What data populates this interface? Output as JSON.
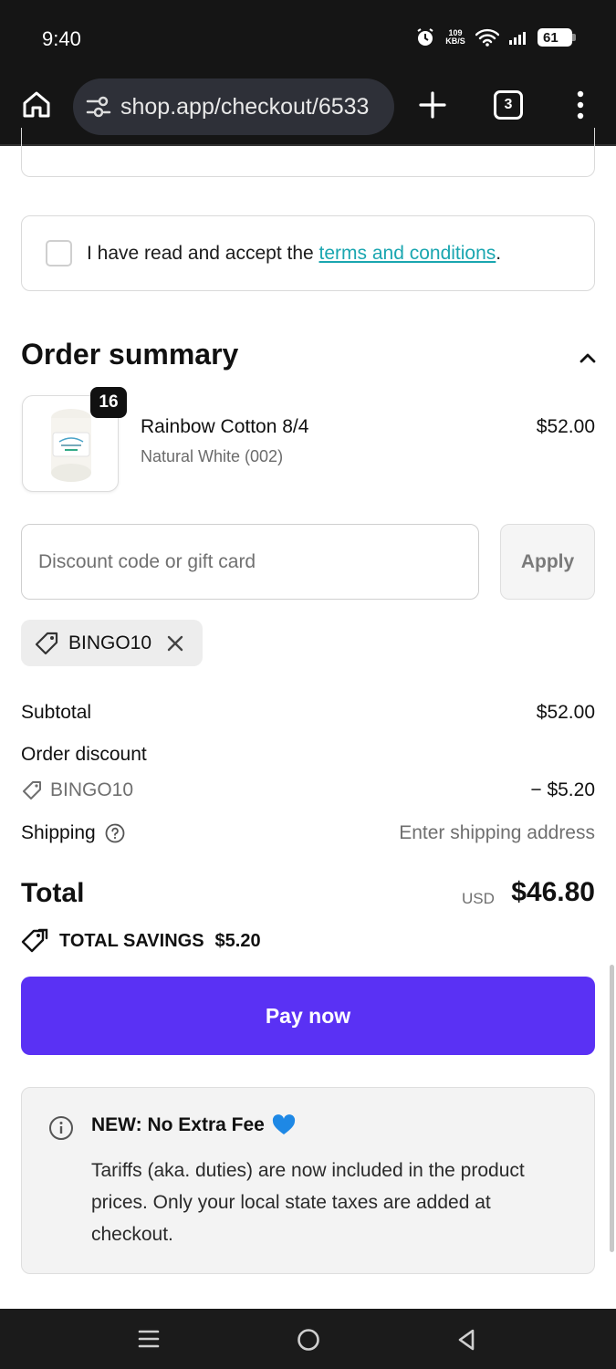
{
  "status_bar": {
    "time": "9:40",
    "net_speed_value": "109",
    "net_speed_unit": "KB/S",
    "battery": "61"
  },
  "browser": {
    "url": "shop.app/checkout/6533",
    "tab_count": "3",
    "icons": [
      "home-icon",
      "tune-icon",
      "plus-icon",
      "tabs-icon",
      "more-vert-icon"
    ]
  },
  "terms": {
    "prefix": "I have read and accept the ",
    "link": "terms and conditions",
    "suffix": "."
  },
  "summary": {
    "title": "Order summary",
    "item": {
      "quantity": "16",
      "name": "Rainbow Cotton 8/4",
      "variant": "Natural White (002)",
      "price": "$52.00"
    },
    "discount_placeholder": "Discount code or gift card",
    "apply_label": "Apply",
    "applied_code": "BINGO10"
  },
  "totals": {
    "subtotal_label": "Subtotal",
    "subtotal_value": "$52.00",
    "order_discount_label": "Order discount",
    "discount_code": "BINGO10",
    "discount_value": "− $5.20",
    "shipping_label": "Shipping",
    "shipping_value": "Enter shipping address",
    "total_label": "Total",
    "currency": "USD",
    "total_value": "$46.80",
    "savings_label": "TOTAL SAVINGS",
    "savings_value": "$5.20"
  },
  "pay_label": "Pay now",
  "notice": {
    "title": "NEW: No Extra Fee",
    "body": "Tariffs (aka. duties) are now included in the product prices. Only your local state taxes are added at checkout."
  },
  "colors": {
    "accent": "#5a31f4",
    "link": "#1aa6b0",
    "heart": "#1e88e5"
  }
}
